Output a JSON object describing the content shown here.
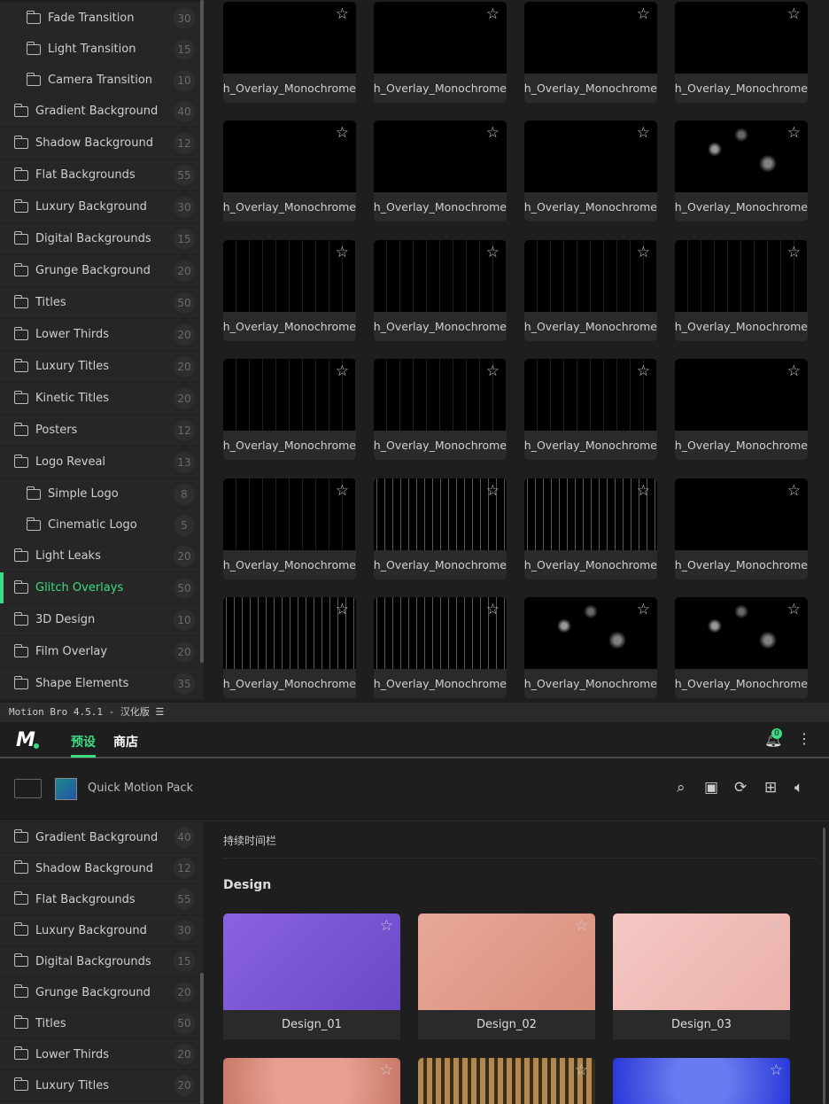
{
  "top_sidebar": [
    {
      "label": "Fade Transition",
      "count": "30",
      "sub": true
    },
    {
      "label": "Light Transition",
      "count": "15",
      "sub": true
    },
    {
      "label": "Camera Transition",
      "count": "10",
      "sub": true
    },
    {
      "label": "Gradient Background",
      "count": "40"
    },
    {
      "label": "Shadow Background",
      "count": "12"
    },
    {
      "label": "Flat Backgrounds",
      "count": "55"
    },
    {
      "label": "Luxury Background",
      "count": "30"
    },
    {
      "label": "Digital Backgrounds",
      "count": "15"
    },
    {
      "label": "Grunge Background",
      "count": "20"
    },
    {
      "label": "Titles",
      "count": "50"
    },
    {
      "label": "Lower Thirds",
      "count": "20"
    },
    {
      "label": "Luxury Titles",
      "count": "20"
    },
    {
      "label": "Kinetic Titles",
      "count": "20"
    },
    {
      "label": "Posters",
      "count": "12"
    },
    {
      "label": "Logo Reveal",
      "count": "13"
    },
    {
      "label": "Simple Logo",
      "count": "8",
      "sub": true
    },
    {
      "label": "Cinematic Logo",
      "count": "5",
      "sub": true
    },
    {
      "label": "Light Leaks",
      "count": "20"
    },
    {
      "label": "Glitch Overlays",
      "count": "50",
      "active": true
    },
    {
      "label": "3D Design",
      "count": "10"
    },
    {
      "label": "Film Overlay",
      "count": "20"
    },
    {
      "label": "Shape Elements",
      "count": "35"
    }
  ],
  "glitch_card_label": "Glitch_Overlay_Monochrome",
  "titlebar": {
    "text": "Motion Bro 4.5.1 - 汉化版  ☰"
  },
  "header": {
    "tabs": [
      "预设",
      "商店"
    ],
    "notification_count": "0",
    "accent": "#3ddc84"
  },
  "pack": {
    "name": "Quick Motion Pack"
  },
  "bottom_sidebar": [
    {
      "label": "Gradient Background",
      "count": "40"
    },
    {
      "label": "Shadow Background",
      "count": "12"
    },
    {
      "label": "Flat Backgrounds",
      "count": "55"
    },
    {
      "label": "Luxury Background",
      "count": "30"
    },
    {
      "label": "Digital Backgrounds",
      "count": "15"
    },
    {
      "label": "Grunge Background",
      "count": "20"
    },
    {
      "label": "Titles",
      "count": "50"
    },
    {
      "label": "Lower Thirds",
      "count": "20"
    },
    {
      "label": "Luxury Titles",
      "count": "20"
    }
  ],
  "main": {
    "duration_bar": "持续时间栏",
    "section": "Design",
    "cards": [
      "Design_01",
      "Design_02",
      "Design_03"
    ]
  }
}
